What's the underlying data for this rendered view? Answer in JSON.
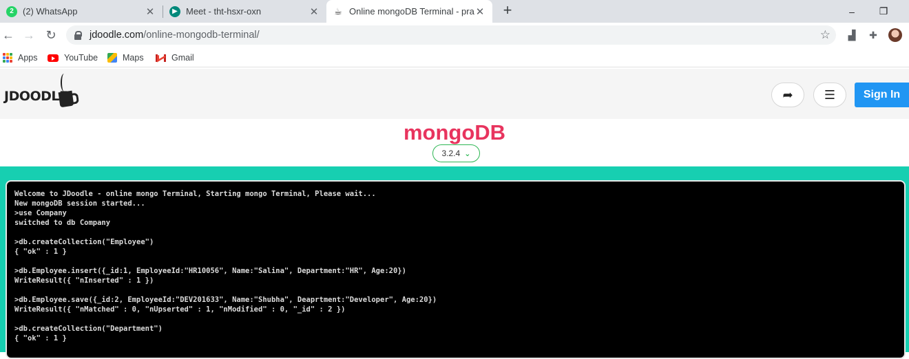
{
  "browser": {
    "tabs": [
      {
        "title": "(2) WhatsApp",
        "favicon": "whatsapp-icon",
        "active": false
      },
      {
        "title": "Meet - tht-hsxr-oxn",
        "favicon": "meet-icon",
        "active": false
      },
      {
        "title": "Online mongoDB Terminal - prac",
        "favicon": "jdoodle-icon",
        "active": true
      }
    ],
    "new_tab_label": "+",
    "window_controls": {
      "minimize": "–",
      "maximize": "❐"
    },
    "address": {
      "host": "jdoodle.com",
      "path": "/online-mongodb-terminal/"
    },
    "bookmarks": [
      "Apps",
      "YouTube",
      "Maps",
      "Gmail"
    ]
  },
  "header": {
    "logo_text": "JDOODLE",
    "sign_in_label": "Sign In"
  },
  "language": {
    "title": "mongoDB",
    "version": "3.2.4"
  },
  "terminal": {
    "lines": [
      "Welcome to JDoodle - online mongo Terminal, Starting mongo Terminal, Please wait...",
      "New mongoDB session started...",
      ">use Company",
      "switched to db Company",
      "",
      ">db.createCollection(\"Employee\")",
      "{ \"ok\" : 1 }",
      "",
      ">db.Employee.insert({_id:1, EmployeeId:\"HR10056\", Name:\"Salina\", Department:\"HR\", Age:20})",
      "WriteResult({ \"nInserted\" : 1 })",
      "",
      ">db.Employee.save({_id:2, EmployeeId:\"DEV201633\", Name:\"Shubha\", Deaprtment:\"Developer\", Age:20})",
      "WriteResult({ \"nMatched\" : 0, \"nUpserted\" : 1, \"nModified\" : 0, \"_id\" : 2 })",
      "",
      ">db.createCollection(\"Department\")",
      "{ \"ok\" : 1 }"
    ]
  },
  "colors": {
    "accent_pink": "#e8345e",
    "teal": "#17cfb1",
    "sign_in_blue": "#2196f3",
    "version_green": "#2db653"
  }
}
